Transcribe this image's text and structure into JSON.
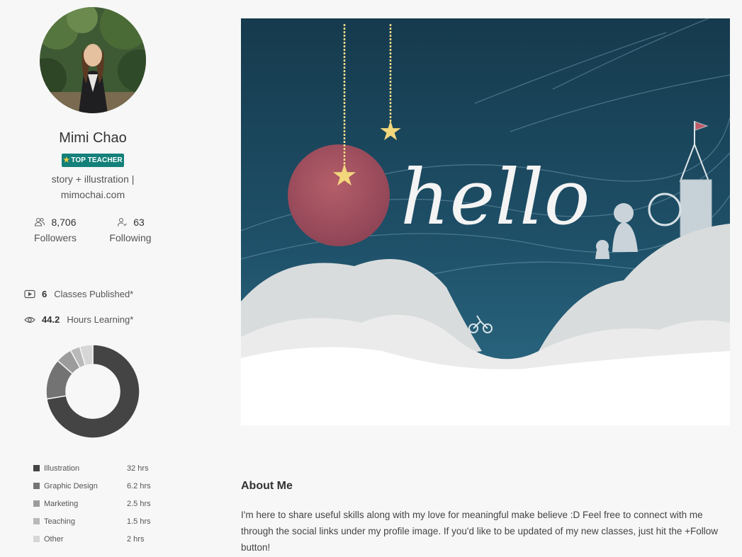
{
  "profile": {
    "name": "Mimi Chao",
    "badge": "TOP TEACHER",
    "tagline": "story + illustration | mimochai.com",
    "followers_count": "8,706",
    "followers_label": "Followers",
    "following_count": "63",
    "following_label": "Following"
  },
  "metrics": {
    "classes_value": "6",
    "classes_label": "Classes Published*",
    "hours_value": "44.2",
    "hours_label": "Hours Learning*"
  },
  "learning_breakdown": [
    {
      "name": "Illustration",
      "hours": "32 hrs",
      "value": 32,
      "color": "#444444"
    },
    {
      "name": "Graphic Design",
      "hours": "6.2 hrs",
      "value": 6.2,
      "color": "#737373"
    },
    {
      "name": "Marketing",
      "hours": "2.5 hrs",
      "value": 2.5,
      "color": "#9c9c9c"
    },
    {
      "name": "Teaching",
      "hours": "1.5 hrs",
      "value": 1.5,
      "color": "#b9b9b9"
    },
    {
      "name": "Other",
      "hours": "2 hrs",
      "value": 2,
      "color": "#d6d6d6"
    }
  ],
  "banner": {
    "text": "hello"
  },
  "about": {
    "title": "About Me",
    "body": "I'm here to share useful skills along with my love for meaningful make believe :D Feel free to connect with me through the social links under my profile image. If you'd like to be updated of my new classes, just hit the +Follow button!"
  },
  "icons": {
    "followers": "people-icon",
    "following": "person-icon",
    "classes": "play-icon",
    "hours": "eye-icon"
  }
}
